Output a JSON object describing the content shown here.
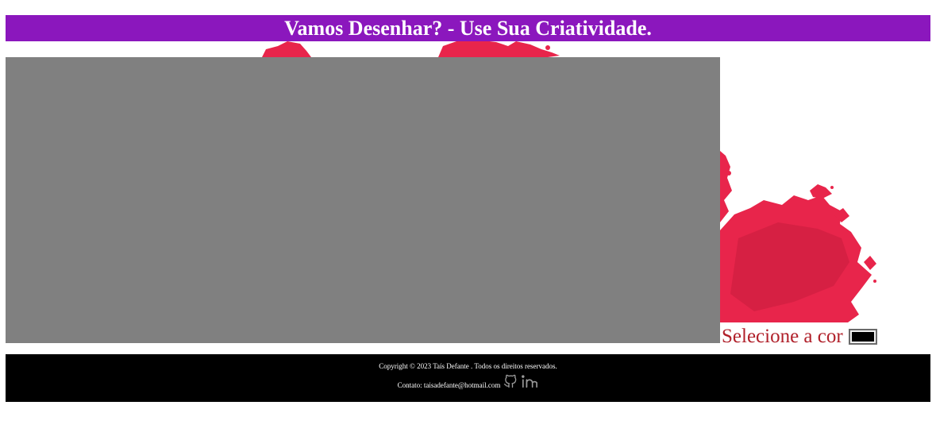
{
  "header": {
    "title": "Vamos Desenhar? - Use Sua Criatividade."
  },
  "canvas": {
    "background_color": "#808080"
  },
  "color_picker": {
    "label": "Selecione a cor",
    "value": "#000000"
  },
  "footer": {
    "copyright": "Copyright © 2023 Taís Defante . Todos os direitos reservados.",
    "contact_label": "Contato:",
    "contact_email": "taisadefante@hotmail.com",
    "icons": [
      "github-icon",
      "linkedin-icon"
    ]
  },
  "colors": {
    "header_bg": "#8b17bd",
    "footer_bg": "#000000",
    "label_color": "#b0202a",
    "splash_color": "#e8254b"
  }
}
